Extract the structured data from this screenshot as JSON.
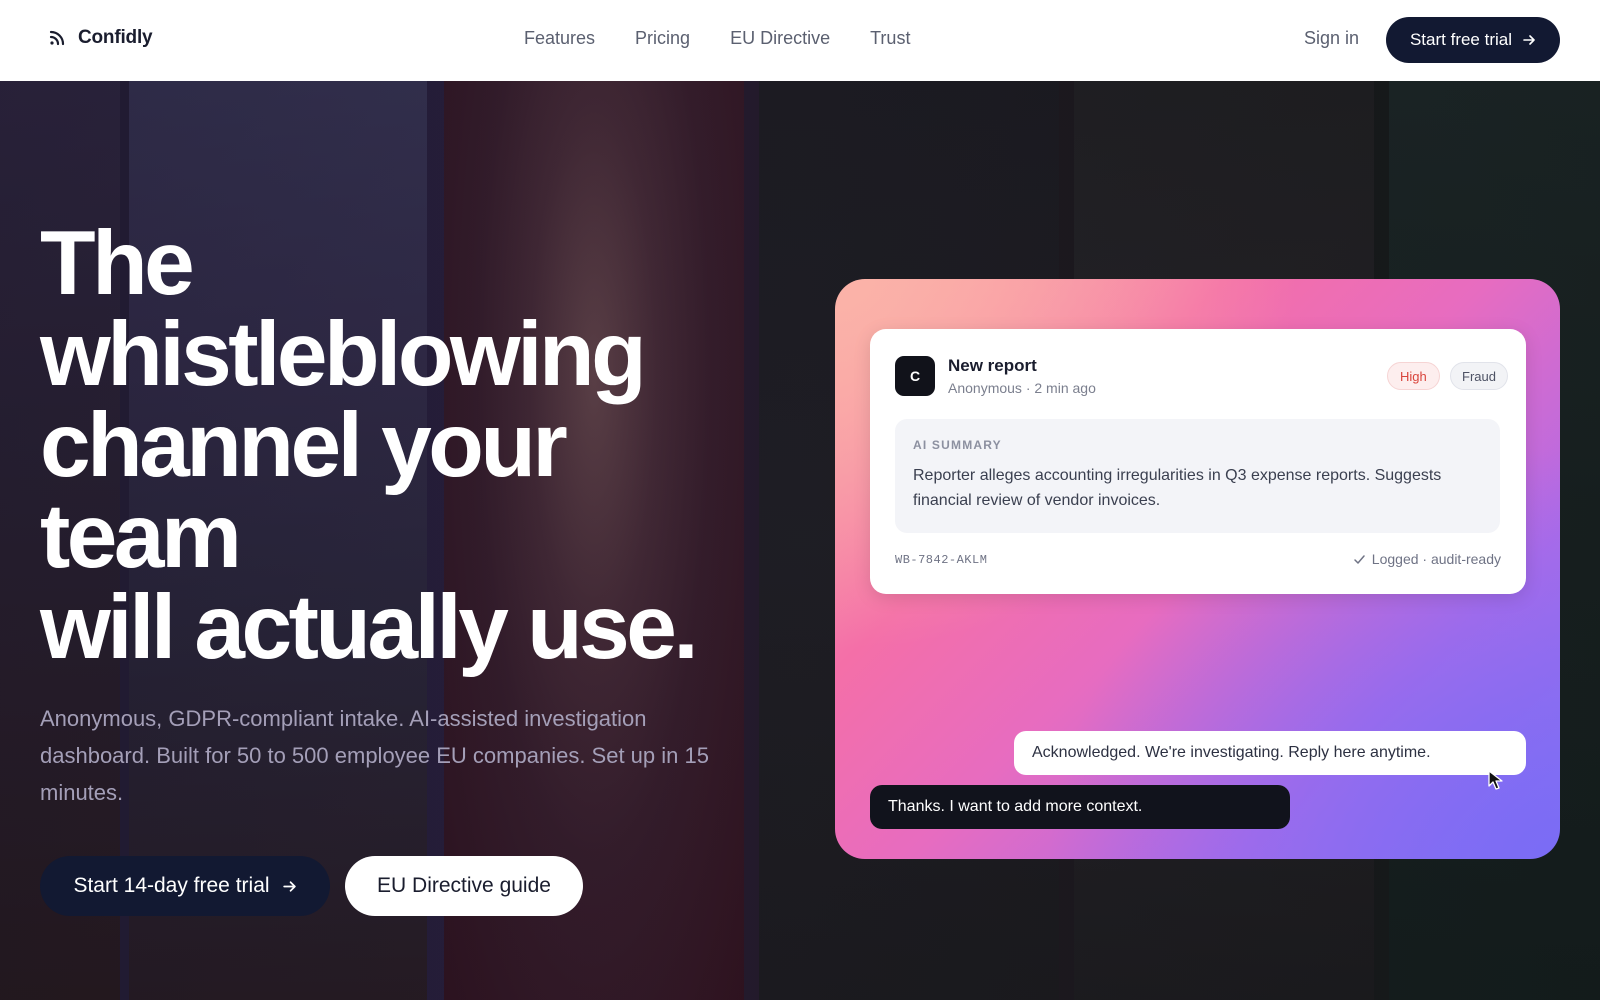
{
  "brand": {
    "name": "Confidly",
    "icon": "signal-icon"
  },
  "nav": {
    "links": [
      "Features",
      "Pricing",
      "EU Directive",
      "Trust"
    ],
    "sign_in": "Sign in",
    "trial_label": "Start free trial"
  },
  "hero": {
    "headline_lines": [
      "The",
      "whistleblowing",
      "channel your",
      "team",
      "will actually use."
    ],
    "subtext": "Anonymous, GDPR-compliant intake. AI-assisted investigation dashboard. Built for 50 to 500 employee EU companies. Set up in 15 minutes.",
    "cta_primary": "Start 14-day free trial",
    "cta_secondary": "EU Directive guide"
  },
  "report_card": {
    "avatar_letter": "C",
    "title": "New report",
    "meta": "Anonymous · 2 min ago",
    "tags": {
      "severity": "High",
      "category": "Fraud"
    },
    "summary_label": "AI SUMMARY",
    "summary_text": "Reporter alleges accounting irregularities in Q3 expense reports. Suggests financial review of vendor invoices.",
    "report_id": "WB-7842-AKLM",
    "status": "Logged · audit-ready"
  },
  "chat": {
    "acknowledgement": "Acknowledged. We're investigating. Reply here anytime.",
    "user_reply": "Thanks. I want to add more context."
  },
  "colors": {
    "nav_bg": "#ffffff",
    "primary_button": "#121932",
    "text_dark": "#1a1d2e",
    "nav_link": "#5b6070",
    "tag_high": "#d9453c",
    "gradient_start": "#f9a7a4",
    "gradient_mid": "#e76cc0",
    "gradient_end": "#8f72f2"
  }
}
